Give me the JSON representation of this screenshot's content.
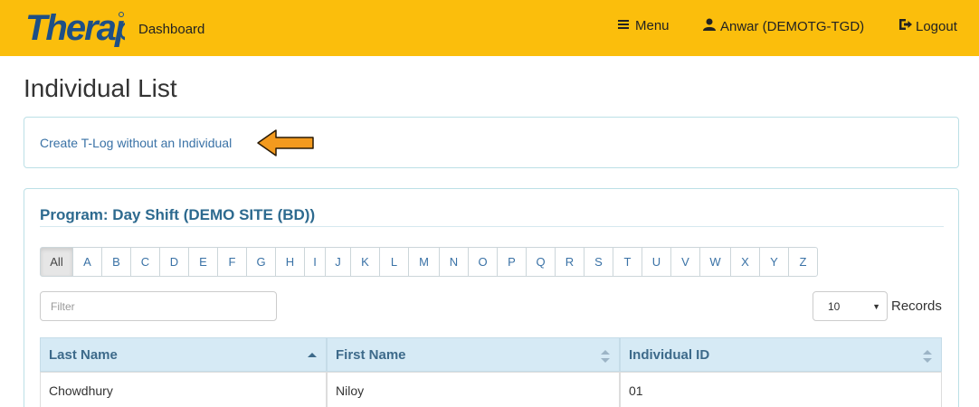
{
  "header": {
    "logo_text": "Therap",
    "dashboard_label": "Dashboard",
    "menu_label": "Menu",
    "user_label": "Anwar (DEMOTG-TGD)",
    "logout_label": "Logout"
  },
  "page": {
    "title": "Individual List"
  },
  "tlog": {
    "link_label": "Create T-Log without an Individual"
  },
  "program": {
    "title": "Program: Day Shift (DEMO SITE (BD))",
    "alphabet": [
      "All",
      "A",
      "B",
      "C",
      "D",
      "E",
      "F",
      "G",
      "H",
      "I",
      "J",
      "K",
      "L",
      "M",
      "N",
      "O",
      "P",
      "Q",
      "R",
      "S",
      "T",
      "U",
      "V",
      "W",
      "X",
      "Y",
      "Z"
    ],
    "selected_letter": "All",
    "filter_placeholder": "Filter",
    "records_value": "10",
    "records_label": "Records"
  },
  "table": {
    "columns": [
      "Last Name",
      "First Name",
      "Individual ID"
    ],
    "rows": [
      [
        "Chowdhury",
        "Niloy",
        "01"
      ]
    ]
  },
  "colors": {
    "header_bg": "#fbbe0c",
    "link": "#3a72a6",
    "program_title": "#2d6a8f",
    "table_header_bg": "#d6eaf5",
    "arrow": "#f39a1e"
  }
}
